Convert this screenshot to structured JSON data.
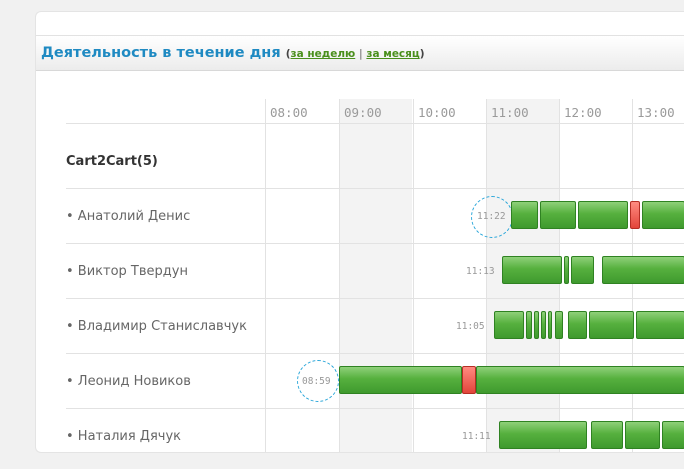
{
  "widget": {
    "title": "Деятельность в течение дня",
    "link_open": "(",
    "link_week": "за неделю",
    "link_sep": " | ",
    "link_month": "за месяц",
    "link_close": ")"
  },
  "timeline": {
    "hours": [
      "08:00",
      "09:00",
      "10:00",
      "11:00",
      "12:00",
      "13:00"
    ],
    "group": "Cart2Cart(5)",
    "rows": [
      {
        "name": "• Анатолий Денис",
        "start": "11:22"
      },
      {
        "name": "• Виктор Твердун",
        "start": "11:13"
      },
      {
        "name": "• Владимир Станиславчук",
        "start": "11:05"
      },
      {
        "name": "• Леонид Новиков",
        "start": "08:59"
      },
      {
        "name": "• Наталия Дячук",
        "start": "11:11"
      }
    ]
  },
  "colors": {
    "active": "#56b03e",
    "idle": "#e2453a",
    "title": "#1f8ac2",
    "highlight": "#29a6d9"
  }
}
